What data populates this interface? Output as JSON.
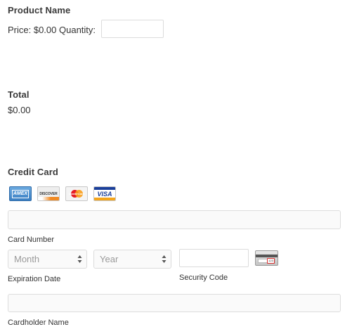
{
  "product": {
    "name": "Product Name",
    "price_label": "Price: $0.00",
    "quantity_label": "Quantity:",
    "quantity_value": ""
  },
  "total": {
    "heading": "Total",
    "value": "$0.00"
  },
  "credit_card": {
    "heading": "Credit Card",
    "logos": {
      "amex": "AMEX",
      "discover": "DISCOVER",
      "mastercard": "MasterCard",
      "visa": "VISA"
    },
    "card_number_label": "Card Number",
    "card_number_value": "",
    "month_placeholder": "Month",
    "year_placeholder": "Year",
    "expiration_label": "Expiration Date",
    "security_code_label": "Security Code",
    "security_code_value": "",
    "cvv_icon_text": "123",
    "cardholder_label": "Cardholder Name",
    "cardholder_value": ""
  },
  "colors": {
    "amex": "#4a8fd0",
    "discover_orange": "#f08a24",
    "mastercard_red": "#e61c24",
    "mastercard_yellow": "#f99f1b",
    "visa_blue": "#1a3f9a",
    "visa_gold": "#f4a51c"
  }
}
